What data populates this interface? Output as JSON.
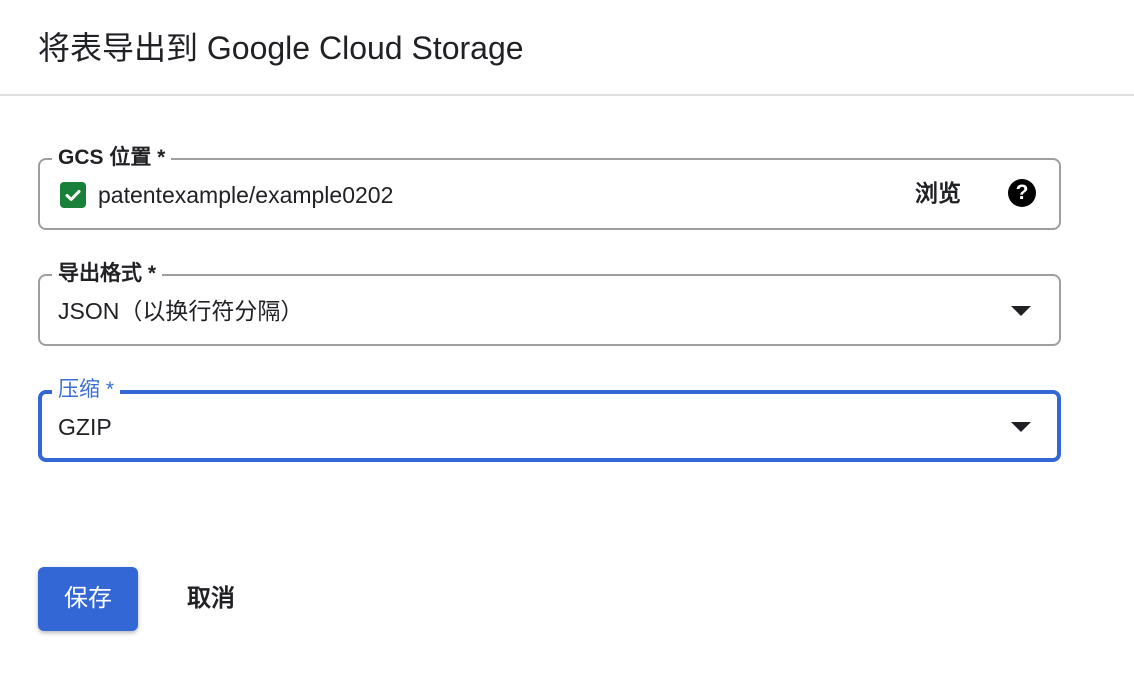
{
  "dialog": {
    "title": "将表导出到 Google Cloud Storage"
  },
  "gcs_location": {
    "label": "GCS 位置 *",
    "value": "patentexample/example0202",
    "browse_label": "浏览",
    "status_icon": "check-icon",
    "help_icon": "help-icon",
    "help_glyph": "?"
  },
  "export_format": {
    "label": "导出格式 *",
    "selected": "JSON（以换行符分隔）",
    "icon": "dropdown-icon"
  },
  "compression": {
    "label": "压缩 *",
    "selected": "GZIP",
    "icon": "dropdown-icon"
  },
  "actions": {
    "save_label": "保存",
    "cancel_label": "取消"
  },
  "colors": {
    "accent": "#3367d6",
    "success": "#188038",
    "border": "#9e9e9e"
  }
}
